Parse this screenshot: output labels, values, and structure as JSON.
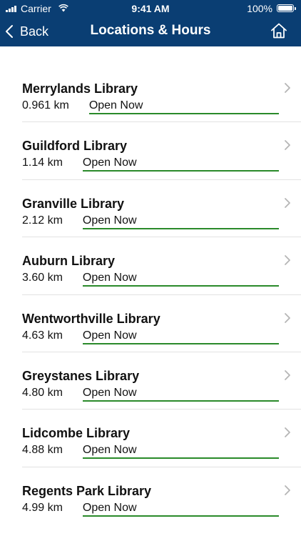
{
  "status_bar": {
    "carrier": "Carrier",
    "time": "9:41 AM",
    "battery": "100%"
  },
  "nav": {
    "back_label": "Back",
    "title": "Locations & Hours"
  },
  "colors": {
    "header_bg": "#0a3e73",
    "open_underline": "#2a8a2a"
  },
  "libraries": [
    {
      "name": "Merrylands Library",
      "distance": "0.961 km",
      "status": "Open Now"
    },
    {
      "name": "Guildford Library",
      "distance": "1.14 km",
      "status": "Open Now"
    },
    {
      "name": "Granville Library",
      "distance": "2.12 km",
      "status": "Open Now"
    },
    {
      "name": "Auburn Library",
      "distance": "3.60 km",
      "status": "Open Now"
    },
    {
      "name": "Wentworthville Library",
      "distance": "4.63 km",
      "status": "Open Now"
    },
    {
      "name": "Greystanes Library",
      "distance": "4.80 km",
      "status": "Open Now"
    },
    {
      "name": "Lidcombe Library",
      "distance": "4.88 km",
      "status": "Open Now"
    },
    {
      "name": "Regents Park Library",
      "distance": "4.99 km",
      "status": "Open Now"
    }
  ]
}
